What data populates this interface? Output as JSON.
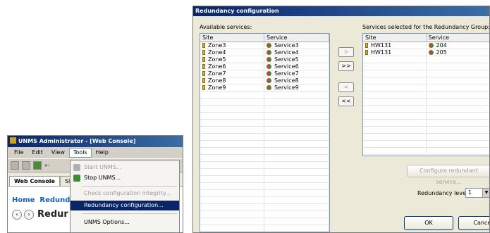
{
  "unms_window": {
    "title": "UNMS Administrator - [Web Console]",
    "menu": [
      "File",
      "Edit",
      "View",
      "Tools",
      "Help"
    ],
    "tabs": [
      "Web Console",
      "Site"
    ],
    "breadcrumb": "Home  Redund",
    "page_title": "Redur"
  },
  "tools_menu": {
    "start": "Start UNMS...",
    "stop": "Stop UNMS...",
    "check": "Check configuration integrity...",
    "redundancy": "Redundancy configuration...",
    "options": "UNMS Options..."
  },
  "dialog": {
    "title": "Redundancy configuration",
    "available_label": "Available services:",
    "selected_label": "Services selected for the Redundancy Group:",
    "columns": {
      "site": "Site",
      "service": "Service"
    },
    "available_rows": [
      {
        "site": "Zone3",
        "service": "Service3"
      },
      {
        "site": "Zone4",
        "service": "Service4"
      },
      {
        "site": "Zone5",
        "service": "Service5"
      },
      {
        "site": "Zone6",
        "service": "Service6"
      },
      {
        "site": "Zone7",
        "service": "Service7"
      },
      {
        "site": "Zone8",
        "service": "Service8"
      },
      {
        "site": "Zone9",
        "service": "Service9"
      }
    ],
    "selected_rows": [
      {
        "site": "HW131",
        "service": "204"
      },
      {
        "site": "HW131",
        "service": "205"
      }
    ],
    "buttons": {
      "add": ">",
      "add_all": ">>",
      "remove": "<",
      "remove_all": "<<",
      "configure": "Configure redundant service...",
      "ok": "OK",
      "cancel": "Cancel"
    },
    "redundancy_label": "Redundancy level:",
    "redundancy_value": "1"
  },
  "colors": {
    "titlebar": "#0a246a",
    "highlight": "#0a246a",
    "link": "#1a5fb4"
  }
}
